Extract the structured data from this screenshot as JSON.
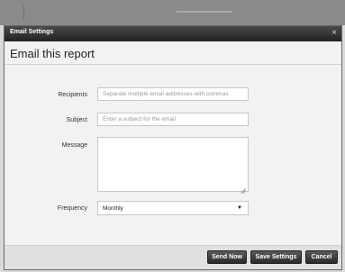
{
  "dialog": {
    "title": "Email Settings",
    "close_glyph": "×",
    "heading": "Email this report"
  },
  "form": {
    "recipients": {
      "label": "Recipients",
      "placeholder": "Separate multiple email addresses with commas"
    },
    "subject": {
      "label": "Subject",
      "placeholder": "Enter a subject for the email"
    },
    "message": {
      "label": "Message"
    },
    "frequency": {
      "label": "Frequency",
      "value": "Monthly",
      "arrow_glyph": "▼"
    }
  },
  "footer": {
    "send_now_label": "Send Now",
    "save_settings_label": "Save Settings",
    "cancel_label": "Cancel"
  },
  "colors": {
    "titlebar": "#2e2e2e",
    "dialog_bg": "#f2f2f2",
    "button_bg": "#3a3a3a"
  }
}
